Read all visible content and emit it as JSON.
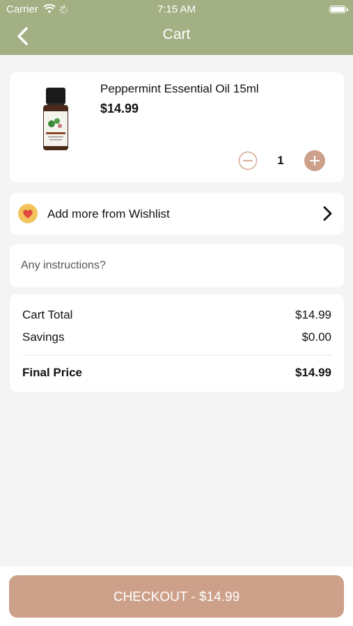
{
  "status_bar": {
    "carrier": "Carrier",
    "time": "7:15 AM"
  },
  "header": {
    "title": "Cart",
    "back_icon": "chevron-left-icon",
    "background": "#a3b084"
  },
  "cart": {
    "items": [
      {
        "name": "Peppermint Essential Oil 15ml",
        "price": "$14.99",
        "quantity": "1",
        "image_icon": "essential-oil-bottle",
        "image_label": "PEPPERMINT"
      }
    ]
  },
  "wishlist": {
    "label": "Add more from Wishlist",
    "icon": "heart-icon"
  },
  "instructions": {
    "placeholder": "Any instructions?",
    "value": ""
  },
  "summary": {
    "cart_total_label": "Cart Total",
    "cart_total_value": "$14.99",
    "savings_label": "Savings",
    "savings_value": "$0.00",
    "final_price_label": "Final Price",
    "final_price_value": "$14.99"
  },
  "checkout": {
    "label": "CHECKOUT - $14.99",
    "color": "#cda08a"
  },
  "colors": {
    "accent": "#cda08a",
    "header": "#a3b084",
    "background": "#f4f4f4"
  }
}
